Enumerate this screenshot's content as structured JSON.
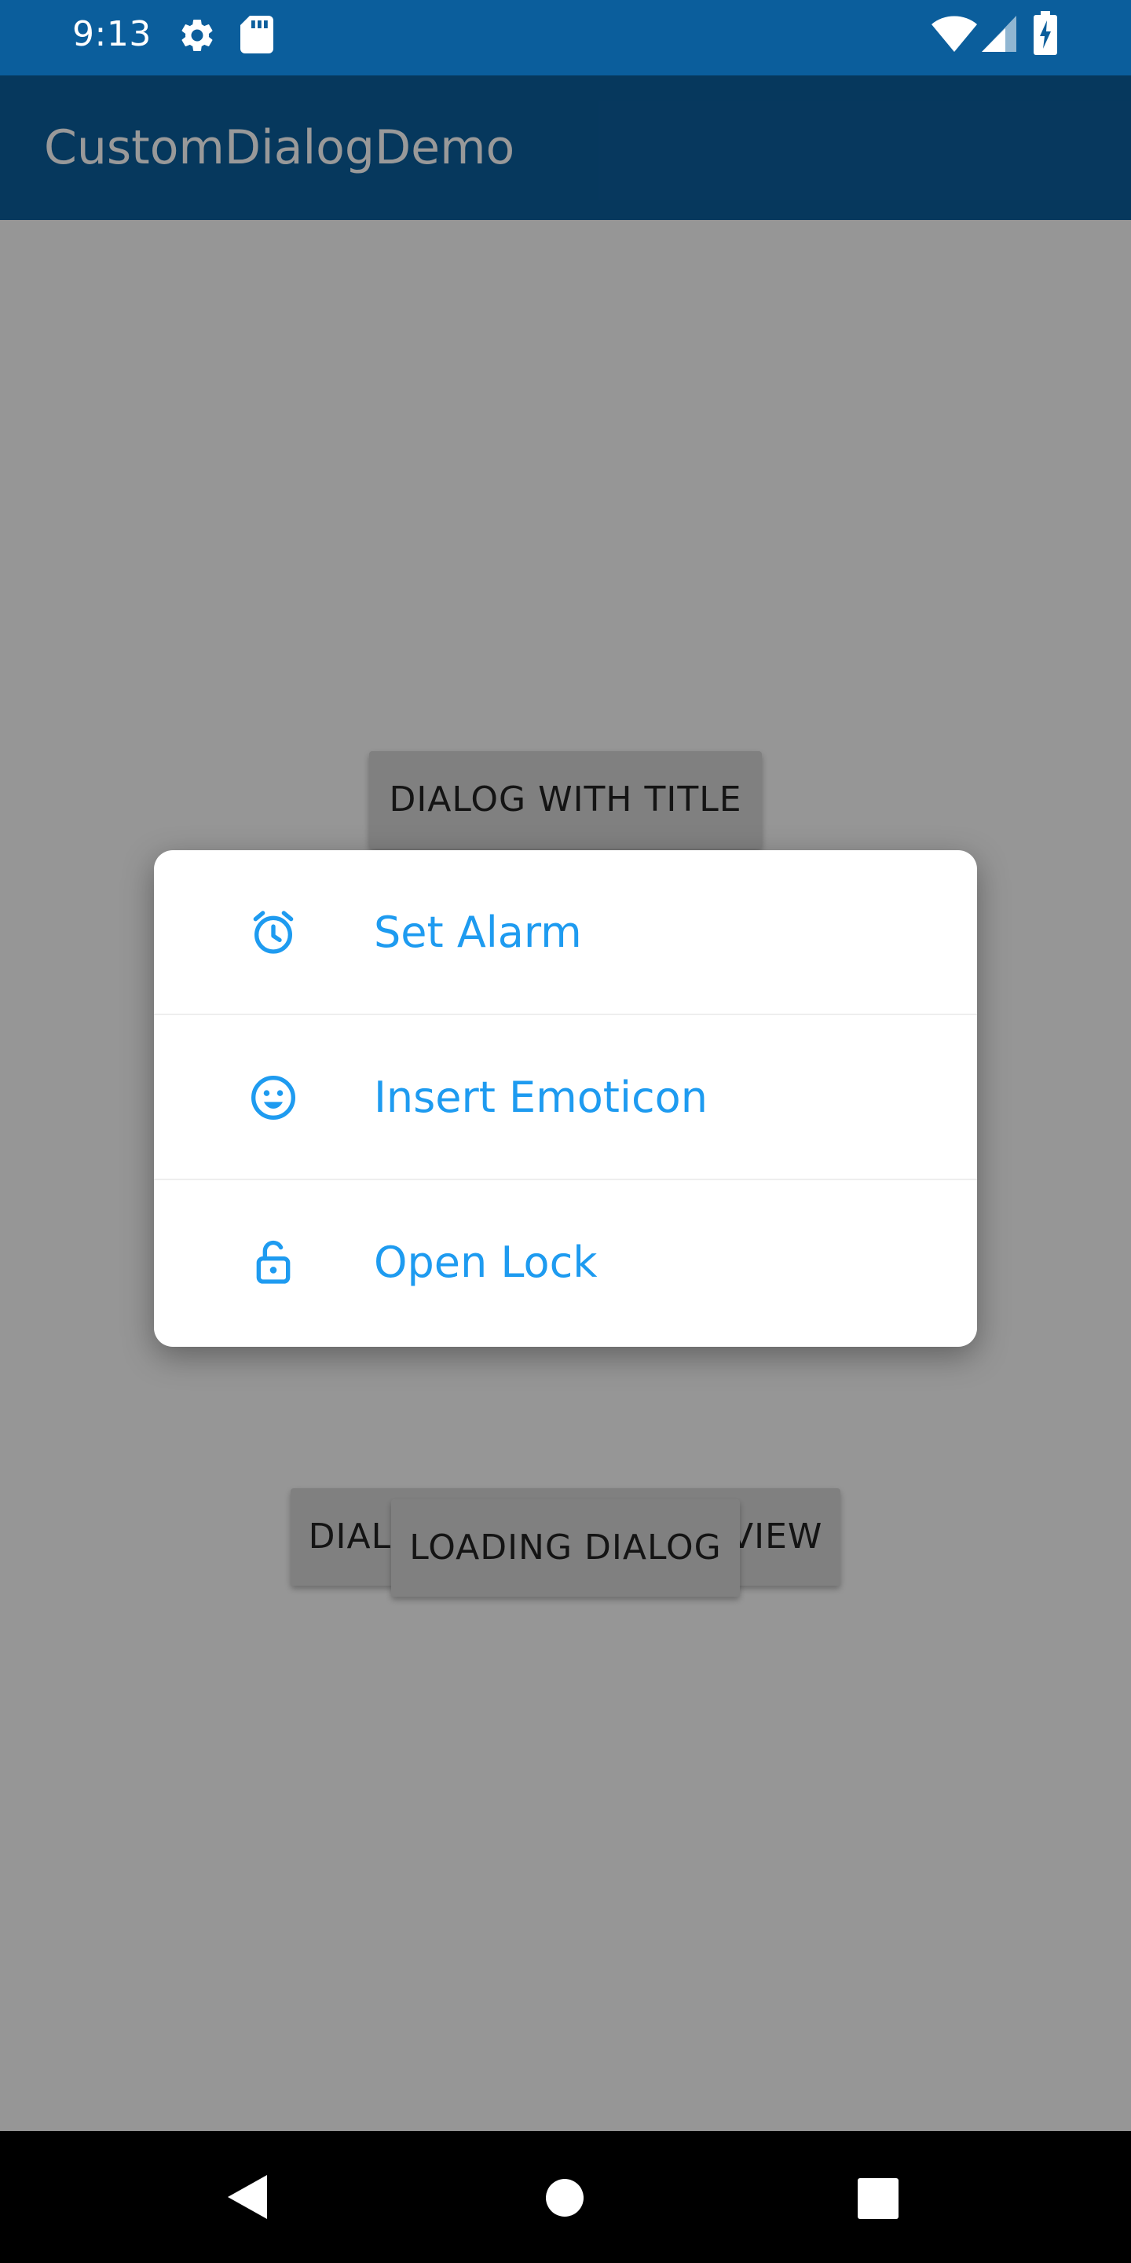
{
  "status_bar": {
    "time": "9:13",
    "icons": [
      "gear-icon",
      "sd-card-icon",
      "wifi-icon",
      "signal-icon",
      "battery-charging-icon"
    ]
  },
  "app_bar": {
    "title": "CustomDialogDemo"
  },
  "buttons": {
    "dialog_with_title": "DIALOG WITH TITLE",
    "dialog_with_custom_view": "DIALOG WITH CUSTOM VIEW",
    "loading_dialog": "LOADING DIALOG"
  },
  "dialog": {
    "items": [
      {
        "label": "Set Alarm",
        "icon": "alarm-clock-icon"
      },
      {
        "label": "Insert Emoticon",
        "icon": "smiley-icon"
      },
      {
        "label": "Open Lock",
        "icon": "unlocked-padlock-icon"
      }
    ]
  },
  "nav_bar": {
    "buttons": [
      "back-triangle-icon",
      "home-circle-icon",
      "recents-square-icon"
    ]
  },
  "colors": {
    "primary": "#0b5e9c",
    "accent": "#1e9bf0",
    "dialog_background": "#ffffff",
    "scrim": "rgba(0,0,0,0.40)"
  }
}
